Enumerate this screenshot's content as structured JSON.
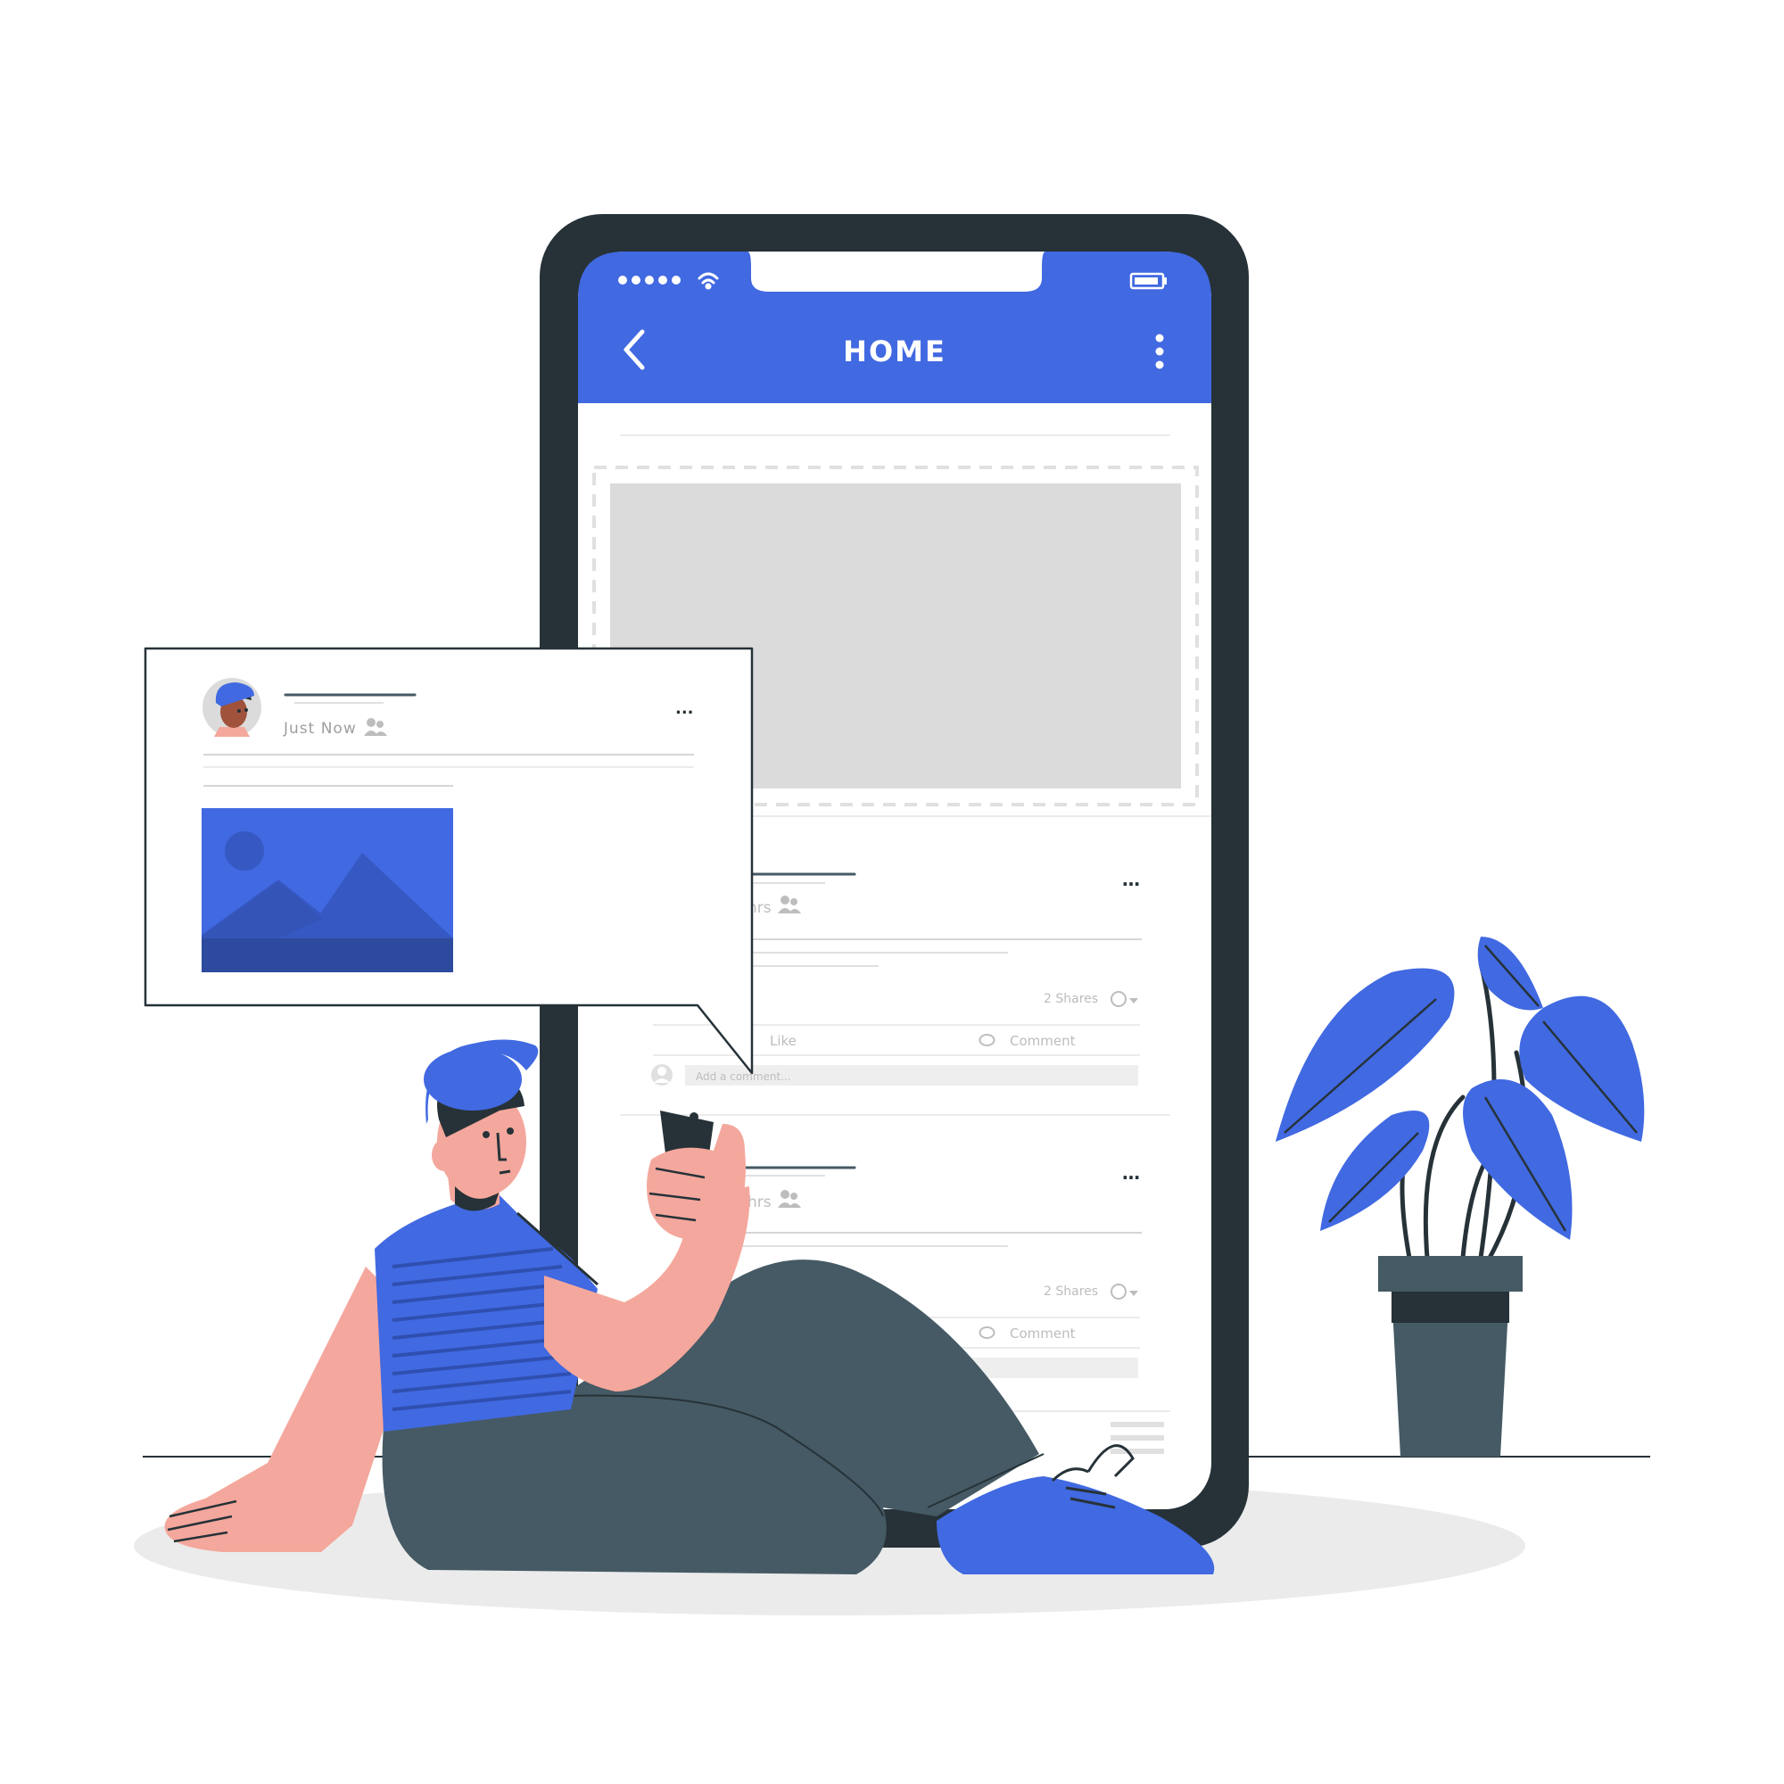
{
  "phone": {
    "title": "HOME",
    "status": {
      "signal_icon": "signal-dots-icon",
      "wifi_icon": "wifi-icon",
      "battery_icon": "battery-icon"
    },
    "back_icon": "back-arrow-icon",
    "menu_icon": "more-vertical-icon"
  },
  "feed": {
    "post1": {
      "time_suffix": "hrs",
      "shares": "2 Shares",
      "like_label": "Like",
      "comment_label": "Comment",
      "comment_placeholder": "Add a comment..."
    },
    "post2": {
      "time_suffix": "hrs",
      "shares": "2 Shares",
      "comment_label": "Comment"
    }
  },
  "popup": {
    "time": "Just Now",
    "more_label": "...",
    "image_icon": "image-placeholder-icon"
  },
  "colors": {
    "accent": "#4169E1",
    "phone_frame": "#263238",
    "pants": "#455A64",
    "skin": "#F4A79C",
    "placeholder": "#DBDBDB"
  }
}
